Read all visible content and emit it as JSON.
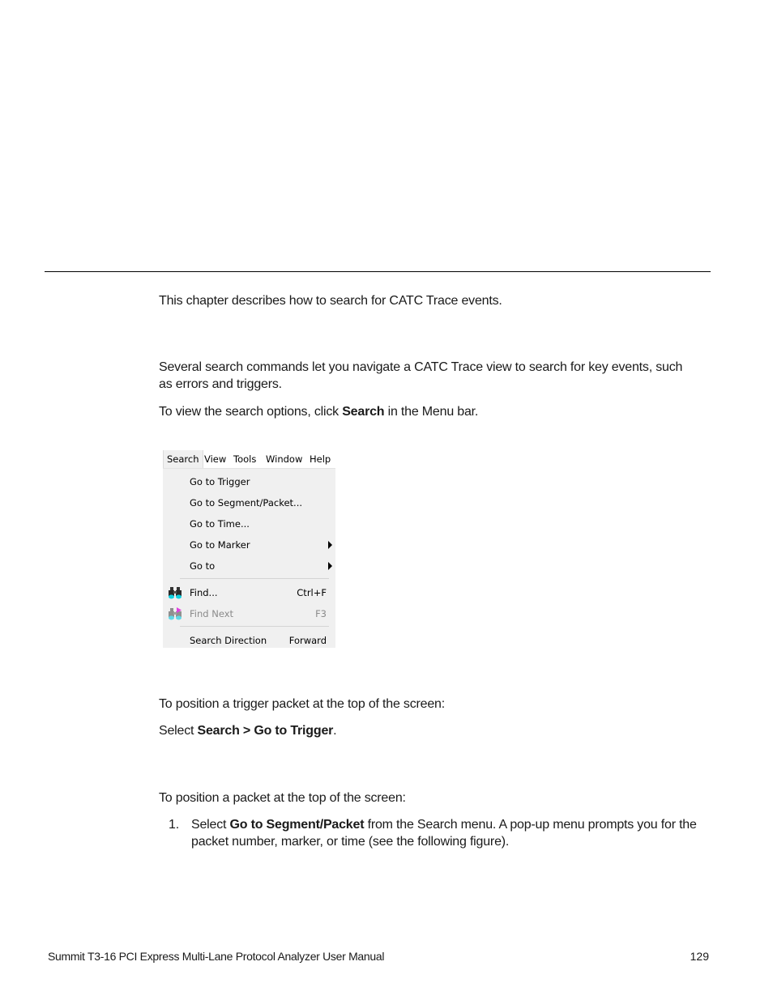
{
  "page": {
    "intro": "This chapter describes how to search for CATC Trace events.",
    "several_text": "Several search commands let you navigate a CATC Trace view to search for key events, such as errors and triggers.",
    "view_options": {
      "before": "To view the search options, click ",
      "bold": "Search",
      "after": " in the Menu bar."
    },
    "trigger_lead": "To position a trigger packet at the top of the screen:",
    "trigger_step": {
      "before": "Select ",
      "bold": "Search > Go to Trigger",
      "after": "."
    },
    "packet_lead": "To position a packet at the top of the screen:",
    "packet_steps": [
      {
        "number": "1.",
        "before": "Select ",
        "bold": "Go to Segment/Packet",
        "after": " from the Search menu. A pop-up menu prompts you for the packet number, marker, or time (see the following figure)."
      }
    ]
  },
  "menu_screenshot": {
    "menubar": [
      "Search",
      "View",
      "Tools",
      "Window",
      "Help"
    ],
    "items": [
      {
        "label": "Go to Trigger"
      },
      {
        "label": "Go to Segment/Packet..."
      },
      {
        "label": "Go to Time..."
      },
      {
        "label": "Go to Marker",
        "submenu": true
      },
      {
        "label": "Go to",
        "submenu": true
      },
      {
        "label": "Find...",
        "shortcut": "Ctrl+F",
        "icon": "binoculars-icon"
      },
      {
        "label": "Find Next",
        "shortcut": "F3",
        "icon": "binoculars-next-icon",
        "disabled": true
      },
      {
        "label": "Search Direction",
        "shortcut": "Forward"
      }
    ]
  },
  "footer": {
    "title": "Summit T3-16 PCI Express Multi-Lane Protocol Analyzer User Manual",
    "page_number": "129"
  }
}
